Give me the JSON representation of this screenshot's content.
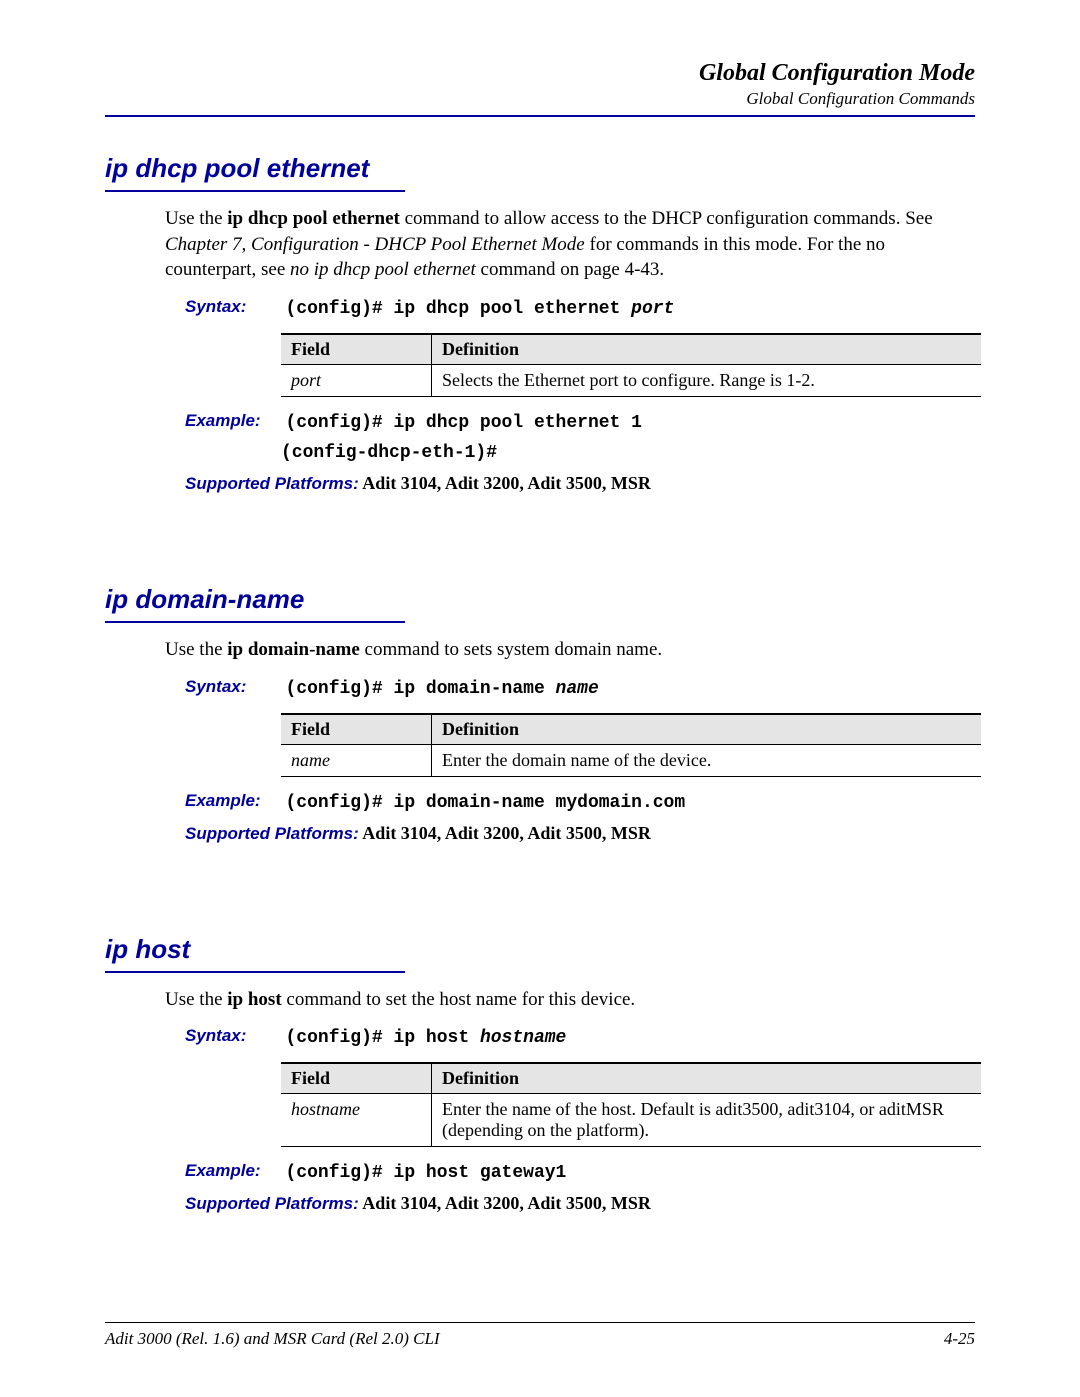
{
  "header": {
    "title": "Global Configuration Mode",
    "sub": "Global Configuration Commands"
  },
  "sections": [
    {
      "title": "ip dhcp pool ethernet",
      "intro_pre": "Use the ",
      "intro_bold": "ip dhcp pool ethernet",
      "intro_post1": " command to allow access to the DHCP configuration commands. See ",
      "intro_ital1": "Chapter 7, Configuration - DHCP Pool Ethernet Mode",
      "intro_post2": " for commands in this mode. For the no counterpart, see ",
      "intro_ital2": "no ip dhcp pool ethernet",
      "intro_post3": " command on page 4-43.",
      "syntax_label": "Syntax:",
      "syntax_cmd": "(config)# ip dhcp pool ethernet ",
      "syntax_arg": "port",
      "field_hdr": "Field",
      "def_hdr": "Definition",
      "field": "port",
      "def": "Selects the Ethernet port to configure. Range is 1-2.",
      "example_label": "Example:",
      "example_cmd": "(config)# ip dhcp pool ethernet 1",
      "example_cmd2": "(config-dhcp-eth-1)#",
      "platforms_label": "Supported Platforms:",
      "platforms": " Adit 3104, Adit 3200, Adit 3500, MSR"
    },
    {
      "title": "ip domain-name",
      "intro_pre": "Use the ",
      "intro_bold": "ip domain-name",
      "intro_post1": " command to sets system domain name.",
      "syntax_label": "Syntax:",
      "syntax_cmd": "(config)# ip domain-name ",
      "syntax_arg": "name",
      "field_hdr": "Field",
      "def_hdr": "Definition",
      "field": "name",
      "def": "Enter the domain name of the device.",
      "example_label": "Example:",
      "example_cmd": "(config)# ip domain-name mydomain.com",
      "platforms_label": "Supported Platforms:",
      "platforms": " Adit 3104, Adit 3200, Adit 3500, MSR"
    },
    {
      "title": "ip host",
      "intro_pre": "Use the ",
      "intro_bold": "ip host",
      "intro_post1": " command to set the host name for this device.",
      "syntax_label": "Syntax:",
      "syntax_cmd": "(config)# ip host ",
      "syntax_arg": "hostname",
      "field_hdr": "Field",
      "def_hdr": "Definition",
      "field": "hostname",
      "def": "Enter the name of the host. Default is adit3500, adit3104, or aditMSR (depending on the platform).",
      "example_label": "Example:",
      "example_cmd": "(config)# ip host gateway1",
      "platforms_label": "Supported Platforms:",
      "platforms": " Adit 3104, Adit 3200, Adit 3500, MSR"
    }
  ],
  "footer": {
    "left": "Adit 3000 (Rel. 1.6) and MSR Card (Rel 2.0) CLI",
    "right": "4-25"
  }
}
